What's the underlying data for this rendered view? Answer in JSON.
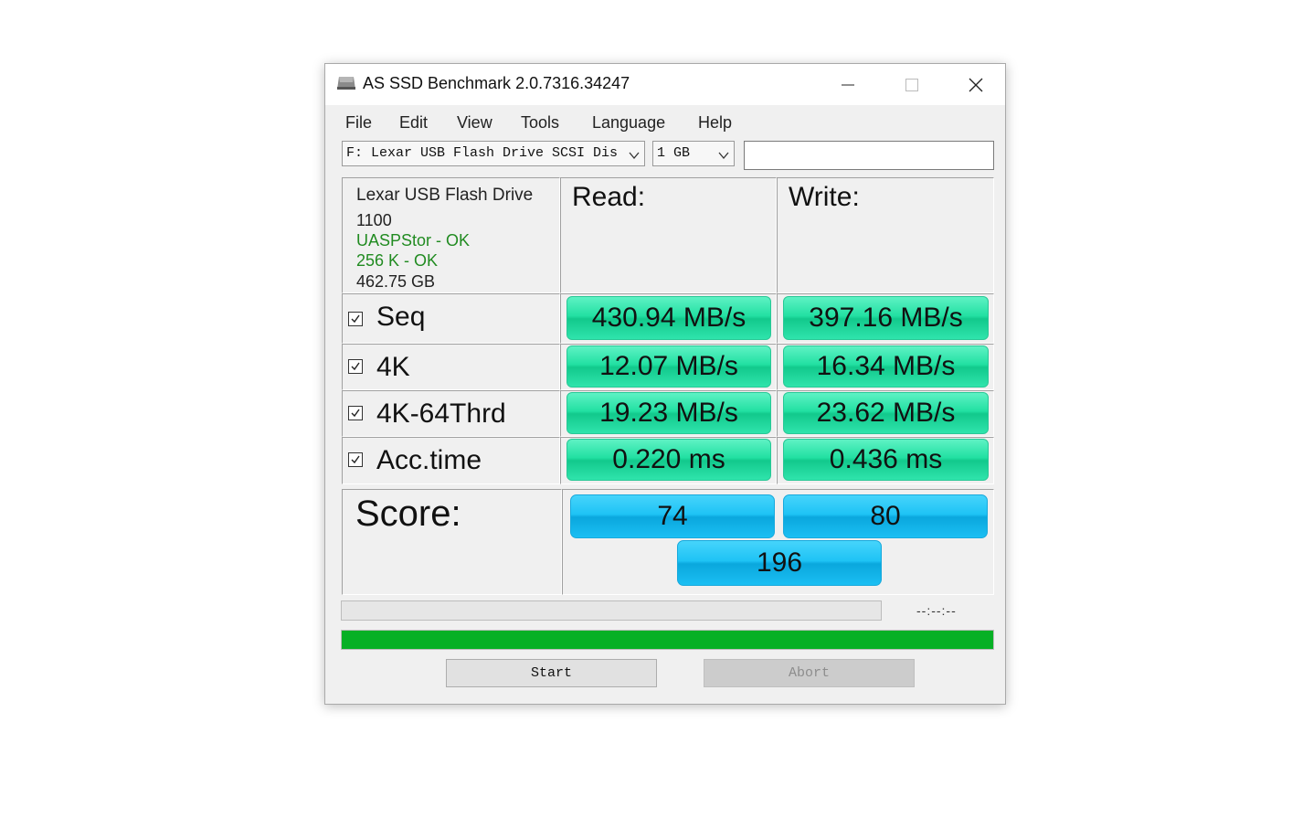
{
  "window": {
    "title": "AS SSD Benchmark 2.0.7316.34247"
  },
  "menu": [
    "File",
    "Edit",
    "View",
    "Tools",
    "Language",
    "Help"
  ],
  "toolbar": {
    "drive_select": "F: Lexar USB Flash Drive SCSI Dis",
    "size_select": "1 GB",
    "text_field": ""
  },
  "drive_info": {
    "name": "Lexar USB Flash Drive",
    "firmware": "1100",
    "driver_status": "UASPStor - OK",
    "alignment_status": "256 K - OK",
    "capacity": "462.75 GB"
  },
  "headers": {
    "read": "Read:",
    "write": "Write:"
  },
  "rows": [
    {
      "label": "Seq",
      "checked": true,
      "read": "430.94 MB/s",
      "write": "397.16 MB/s"
    },
    {
      "label": "4K",
      "checked": true,
      "read": "12.07 MB/s",
      "write": "16.34 MB/s"
    },
    {
      "label": "4K-64Thrd",
      "checked": true,
      "read": "19.23 MB/s",
      "write": "23.62 MB/s"
    },
    {
      "label": "Acc.time",
      "checked": true,
      "read": "0.220 ms",
      "write": "0.436 ms"
    }
  ],
  "score": {
    "label": "Score:",
    "read": "74",
    "write": "80",
    "total": "196"
  },
  "progress": {
    "time": "--:--:--",
    "overall_fraction": 1.0,
    "current_fraction": 0.0
  },
  "buttons": {
    "start": "Start",
    "abort": "Abort"
  },
  "colors": {
    "result_bar": "#22e0a2",
    "score_bar": "#1ec3f5",
    "ok_text": "#218b21",
    "progress_fill": "#06b025"
  }
}
